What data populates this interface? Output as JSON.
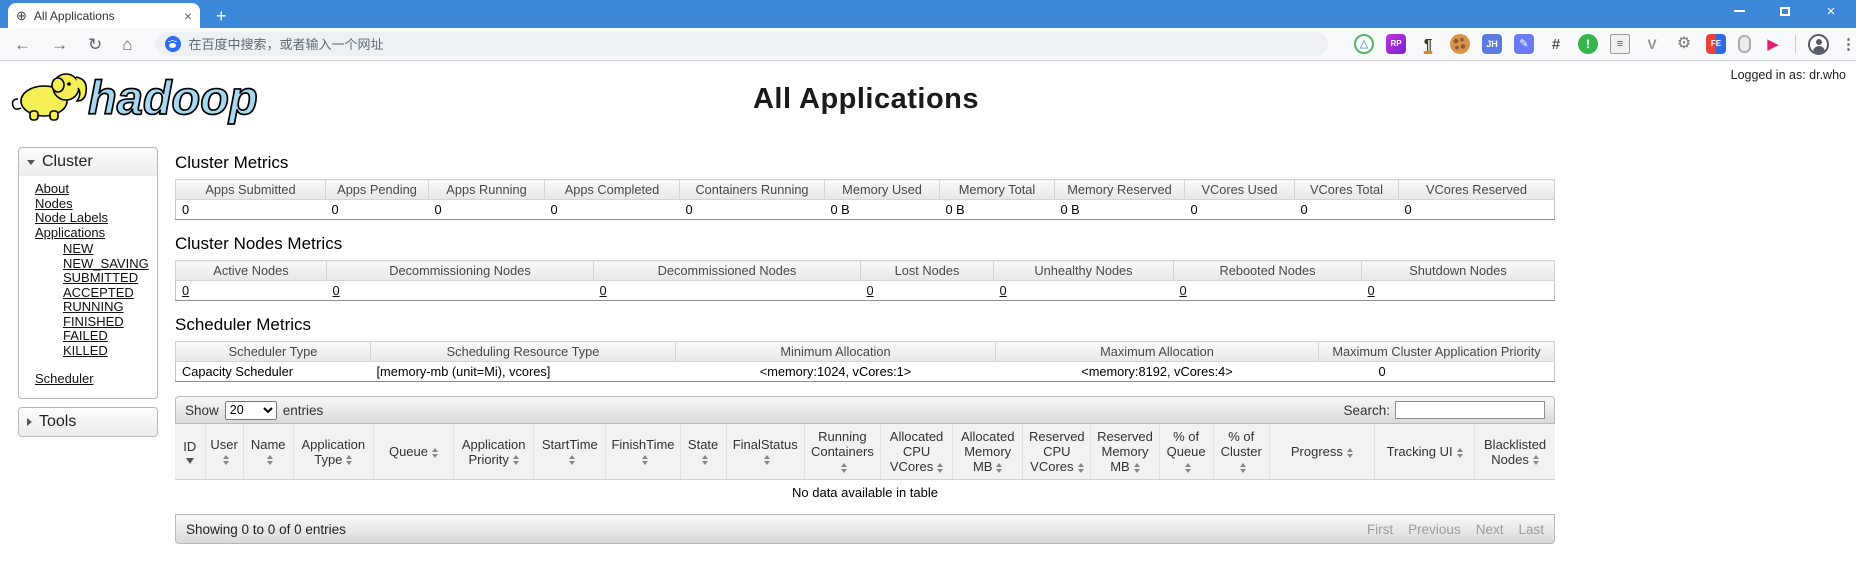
{
  "colors": {
    "chrome_blue": "#3d87d8",
    "logo_yellow": "#f3ef55",
    "logo_blue": "#a8d8f0",
    "toolbar_gray": "#f8f9fa"
  },
  "browser": {
    "tab": {
      "favicon_glyph": "⊕",
      "title": "All Applications",
      "close_glyph": "×"
    },
    "new_tab_glyph": "+",
    "window_close_glyph": "×",
    "nav": {
      "back_glyph": "←",
      "forward_glyph": "→",
      "reload_glyph": "↻",
      "home_glyph": "⌂"
    },
    "address_placeholder": "在百度中搜索，或者输入一个网址",
    "extensions": [
      {
        "name": "graphql",
        "glyph": "△"
      },
      {
        "name": "axure-rp",
        "glyph": "RP"
      },
      {
        "name": "paragraph-formatter",
        "glyph": "¶"
      },
      {
        "name": "cookie-manager",
        "glyph": ""
      },
      {
        "name": "jh-tool",
        "glyph": "JH"
      },
      {
        "name": "notes-editor",
        "glyph": "✎"
      },
      {
        "name": "screenshot-frame",
        "glyph": "#"
      },
      {
        "name": "timer-alert",
        "glyph": "!"
      },
      {
        "name": "session-tabs",
        "glyph": "≡"
      },
      {
        "name": "vue-devtools",
        "glyph": "V"
      },
      {
        "name": "settings-gear",
        "glyph": "⚙"
      },
      {
        "name": "fe-helper",
        "glyph": "FE"
      },
      {
        "name": "mouse-gestures",
        "glyph": ""
      },
      {
        "name": "media-downloader",
        "glyph": "▶"
      }
    ],
    "menu_glyph": "⋮"
  },
  "page": {
    "logged_in_as": "Logged in as: dr.who",
    "logo_text": "hadoop",
    "title": "All Applications",
    "sidebar": {
      "cluster_label": "Cluster",
      "cluster_items": [
        "About",
        "Nodes",
        "Node Labels",
        "Applications"
      ],
      "app_states": [
        "NEW",
        "NEW_SAVING",
        "SUBMITTED",
        "ACCEPTED",
        "RUNNING",
        "FINISHED",
        "FAILED",
        "KILLED"
      ],
      "scheduler_label": "Scheduler",
      "tools_label": "Tools"
    },
    "cluster_metrics": {
      "heading": "Cluster Metrics",
      "columns": [
        "Apps Submitted",
        "Apps Pending",
        "Apps Running",
        "Apps Completed",
        "Containers Running",
        "Memory Used",
        "Memory Total",
        "Memory Reserved",
        "VCores Used",
        "VCores Total",
        "VCores Reserved"
      ],
      "values": [
        "0",
        "0",
        "0",
        "0",
        "0",
        "0 B",
        "0 B",
        "0 B",
        "0",
        "0",
        "0"
      ]
    },
    "cluster_nodes_metrics": {
      "heading": "Cluster Nodes Metrics",
      "columns": [
        "Active Nodes",
        "Decommissioning Nodes",
        "Decommissioned Nodes",
        "Lost Nodes",
        "Unhealthy Nodes",
        "Rebooted Nodes",
        "Shutdown Nodes"
      ],
      "values": [
        "0",
        "0",
        "0",
        "0",
        "0",
        "0",
        "0"
      ]
    },
    "scheduler_metrics": {
      "heading": "Scheduler Metrics",
      "columns": [
        "Scheduler Type",
        "Scheduling Resource Type",
        "Minimum Allocation",
        "Maximum Allocation",
        "Maximum Cluster Application Priority"
      ],
      "values": [
        "Capacity Scheduler",
        "[memory-mb (unit=Mi), vcores]",
        "<memory:1024, vCores:1>",
        "<memory:8192, vCores:4>",
        "0"
      ]
    },
    "apps_table": {
      "show_label": "Show",
      "page_size": "20",
      "entries_label": "entries",
      "search_label": "Search:",
      "search_value": "",
      "columns": [
        "ID",
        "User",
        "Name",
        "Application Type",
        "Queue",
        "Application Priority",
        "StartTime",
        "FinishTime",
        "State",
        "FinalStatus",
        "Running Containers",
        "Allocated CPU VCores",
        "Allocated Memory MB",
        "Reserved CPU VCores",
        "Reserved Memory MB",
        "% of Queue",
        "% of Cluster",
        "Progress",
        "Tracking UI",
        "Blacklisted Nodes"
      ],
      "empty_text": "No data available in table",
      "info_text": "Showing 0 to 0 of 0 entries",
      "pagination": [
        "First",
        "Previous",
        "Next",
        "Last"
      ]
    }
  }
}
